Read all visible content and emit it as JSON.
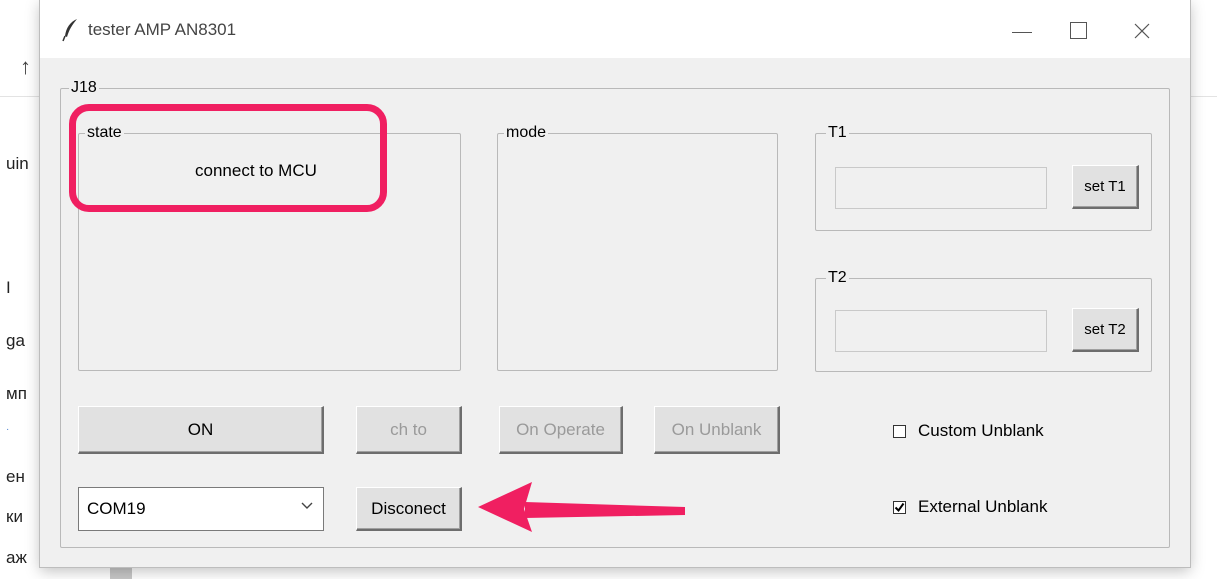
{
  "background": {
    "up_arrow": "↑",
    "side_texts": [
      "uin",
      "I",
      "ga",
      "мп",
      "ен",
      "ки",
      "аж"
    ],
    "dot": "·"
  },
  "window": {
    "title": "tester AMP AN8301",
    "icon": "feather-icon",
    "controls": [
      "minimize-icon",
      "maximize-icon",
      "close-icon"
    ]
  },
  "main_group": {
    "label": "J18"
  },
  "state": {
    "label": "state",
    "text": "connect to MCU"
  },
  "mode": {
    "label": "mode"
  },
  "t1": {
    "label": "T1",
    "value": "",
    "button": "set T1"
  },
  "t2": {
    "label": "T2",
    "value": "",
    "button": "set T2"
  },
  "buttons": {
    "on": "ON",
    "ch_to": "ch to",
    "on_operate": "On Operate",
    "on_unblank": "On Unblank",
    "disconnect": "Disconect"
  },
  "port_select": {
    "value": "COM19"
  },
  "checkboxes": {
    "custom_unblank": {
      "label": "Custom Unblank",
      "checked": false
    },
    "external_unblank": {
      "label": "External Unblank",
      "checked": true
    }
  },
  "annotations": {
    "color": "#f01f61"
  }
}
